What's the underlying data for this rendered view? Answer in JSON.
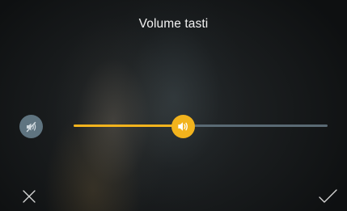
{
  "header": {
    "title": "Volume tasti"
  },
  "volume": {
    "level": 0.43
  },
  "icons": {
    "mute": "speaker-muted-icon",
    "thumb": "speaker-volume-icon",
    "cancel": "close-icon",
    "confirm": "checkmark-icon"
  },
  "colors": {
    "accent": "#f2b31d",
    "track": "#5a6a74",
    "mute_button": "#5f7480",
    "text": "#f2f2f2"
  }
}
